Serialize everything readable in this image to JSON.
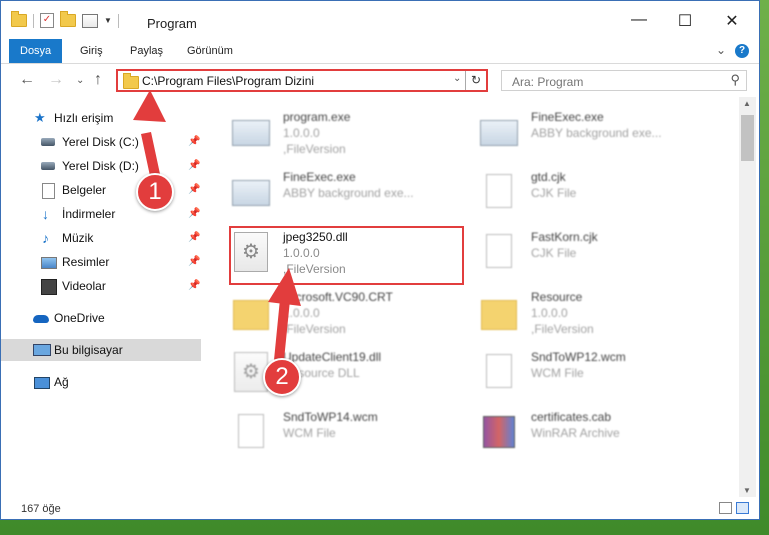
{
  "window": {
    "title": "Program",
    "controls": {
      "minimize": "—",
      "maximize": "☐",
      "close": "✕"
    }
  },
  "ribbon": {
    "tabs": [
      {
        "label": "Dosya",
        "active": true
      },
      {
        "label": "Giriş"
      },
      {
        "label": "Paylaş"
      },
      {
        "label": "Görünüm"
      }
    ],
    "help": "?"
  },
  "address": {
    "path": "C:\\Program Files\\Program Dizini",
    "refresh_icon": "↻"
  },
  "search": {
    "placeholder": "Ara: Program"
  },
  "nav": {
    "items": [
      {
        "label": "Hızlı erişim",
        "icon": "star-icon"
      },
      {
        "label": "Yerel Disk (C:)",
        "icon": "disk-icon",
        "pinned": true
      },
      {
        "label": "Yerel Disk (D:)",
        "icon": "disk-icon",
        "pinned": true
      },
      {
        "label": "Belgeler",
        "icon": "documents-icon",
        "pinned": true
      },
      {
        "label": "İndirmeler",
        "icon": "download-icon",
        "pinned": true
      },
      {
        "label": "Müzik",
        "icon": "music-icon",
        "pinned": true
      },
      {
        "label": "Resimler",
        "icon": "pictures-icon",
        "pinned": true
      },
      {
        "label": "Videolar",
        "icon": "videos-icon",
        "pinned": true
      },
      {
        "label": "OneDrive",
        "icon": "onedrive-icon"
      },
      {
        "label": "Bu bilgisayar",
        "icon": "computer-icon",
        "selected": true
      },
      {
        "label": "Ağ",
        "icon": "network-icon"
      }
    ]
  },
  "files": [
    {
      "name": "program.exe",
      "line1": "1.0.0.0",
      "line2": ",FileVersion",
      "icon": "exe-icon"
    },
    {
      "name": "FineExec.exe",
      "line1": "ABBY background exe...",
      "line2": "",
      "icon": "exe-icon"
    },
    {
      "name": "FineExec.exe",
      "line1": "ABBY background exe...",
      "line2": "",
      "icon": "exe-icon"
    },
    {
      "name": "gtd.cjk",
      "line1": "CJK File",
      "line2": "",
      "icon": "file-icon"
    },
    {
      "name": "jpeg3250.dll",
      "line1": "1.0.0.0",
      "line2": ",FileVersion",
      "icon": "dll-icon"
    },
    {
      "name": "FastKorn.cjk",
      "line1": "CJK File",
      "line2": "",
      "icon": "file-icon"
    },
    {
      "name": "Microsoft.VC90.CRT",
      "line1": "1.0.0.0",
      "line2": ",FileVersion",
      "icon": "folder-icon"
    },
    {
      "name": "Resource",
      "line1": "1.0.0.0",
      "line2": ",FileVersion",
      "icon": "folder-icon"
    },
    {
      "name": "UpdateClient19.dll",
      "line1": "Resource DLL",
      "line2": "",
      "icon": "dll-icon"
    },
    {
      "name": "SndToWP12.wcm",
      "line1": "WCM File",
      "line2": "",
      "icon": "file-icon"
    },
    {
      "name": "SndToWP14.wcm",
      "line1": "WCM File",
      "line2": "",
      "icon": "file-icon"
    },
    {
      "name": "certificates.cab",
      "line1": "WinRAR Archive",
      "line2": "",
      "icon": "archive-icon"
    }
  ],
  "status": {
    "count": "167 öğe"
  },
  "annotations": {
    "step1": "1",
    "step2": "2"
  },
  "colors": {
    "accent": "#1979ca",
    "highlight": "#e23d3d"
  }
}
